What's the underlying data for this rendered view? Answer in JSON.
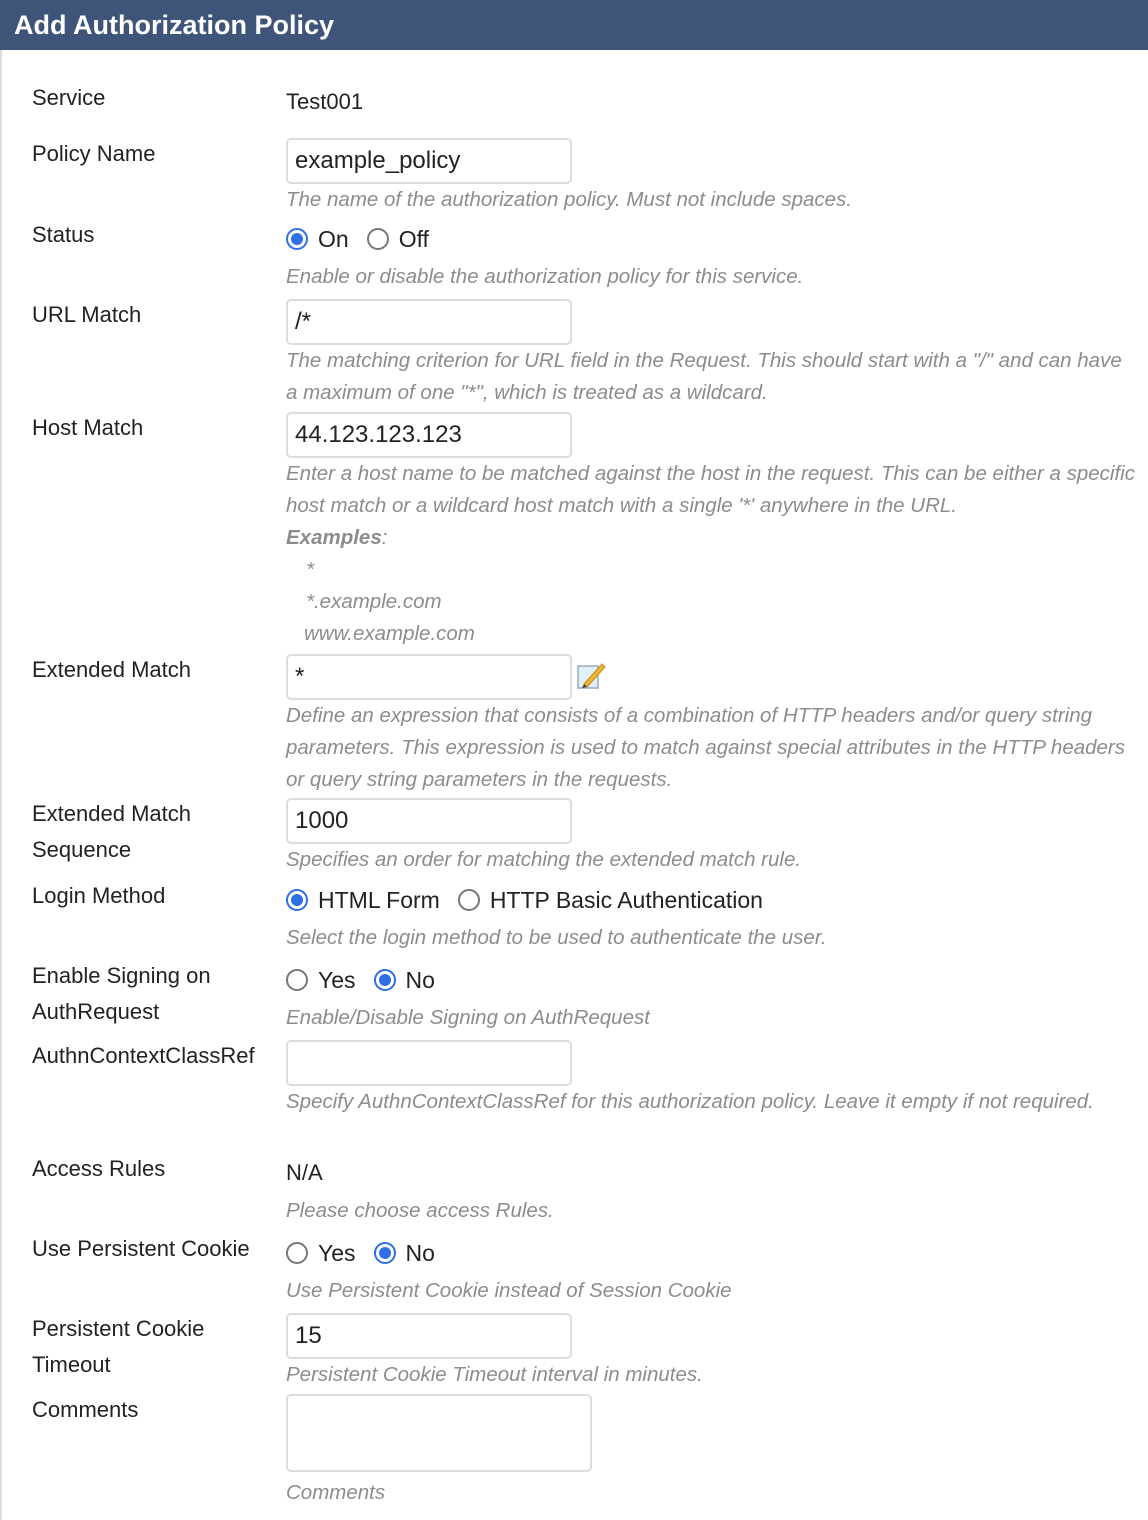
{
  "header": {
    "title": "Add Authorization Policy"
  },
  "form": {
    "service": {
      "label": "Service",
      "value": "Test001"
    },
    "policy_name": {
      "label": "Policy Name",
      "value": "example_policy",
      "help": "The name of the authorization policy. Must not include spaces."
    },
    "status": {
      "label": "Status",
      "options": [
        "On",
        "Off"
      ],
      "selected": "On",
      "help": "Enable or disable the authorization policy for this service."
    },
    "url_match": {
      "label": "URL Match",
      "value": "/*",
      "help": "The matching criterion for URL field in the Request. This should start with a \"/\" and can have a maximum of one \"*\", which is treated as a wildcard."
    },
    "host_match": {
      "label": "Host Match",
      "value": "44.123.123.123",
      "help": "Enter a host name to be matched against the host in the request. This can be either a specific host match or a wildcard host match with a single '*' anywhere in the URL.",
      "examples_label": "Examples",
      "examples": [
        "*",
        "*.example.com",
        "www.example.com"
      ]
    },
    "extended_match": {
      "label": "Extended Match",
      "value": "*",
      "edit_icon": "edit-pencil-icon",
      "help": "Define an expression that consists of a combination of HTTP headers and/or query string parameters. This expression is used to match against special attributes in the HTTP headers or query string parameters in the requests."
    },
    "extended_match_sequence": {
      "label_line1": "Extended Match",
      "label_line2": "Sequence",
      "value": "1000",
      "help": "Specifies an order for matching the extended match rule."
    },
    "login_method": {
      "label": "Login Method",
      "options": [
        "HTML Form",
        "HTTP Basic Authentication"
      ],
      "selected": "HTML Form",
      "help": "Select the login method to be used to authenticate the user."
    },
    "enable_signing": {
      "label_line1": "Enable Signing on",
      "label_line2": "AuthRequest",
      "options": [
        "Yes",
        "No"
      ],
      "selected": "No",
      "help": "Enable/Disable Signing on AuthRequest"
    },
    "authn_context_class_ref": {
      "label": "AuthnContextClassRef",
      "value": "",
      "help": "Specify AuthnContextClassRef for this authorization policy. Leave it empty if not required."
    },
    "access_rules": {
      "label": "Access Rules",
      "value": "N/A",
      "help": "Please choose access Rules."
    },
    "use_persistent_cookie": {
      "label": "Use Persistent Cookie",
      "options": [
        "Yes",
        "No"
      ],
      "selected": "No",
      "help": "Use Persistent Cookie instead of Session Cookie"
    },
    "persistent_cookie_timeout": {
      "label_line1": "Persistent Cookie",
      "label_line2": "Timeout",
      "value": "15",
      "help": "Persistent Cookie Timeout interval in minutes."
    },
    "comments": {
      "label": "Comments",
      "value": "",
      "help": "Comments"
    }
  },
  "colors": {
    "header_bg": "#3e5479",
    "radio_accent": "#2f6fe4",
    "help_text": "#8c8c8c"
  }
}
